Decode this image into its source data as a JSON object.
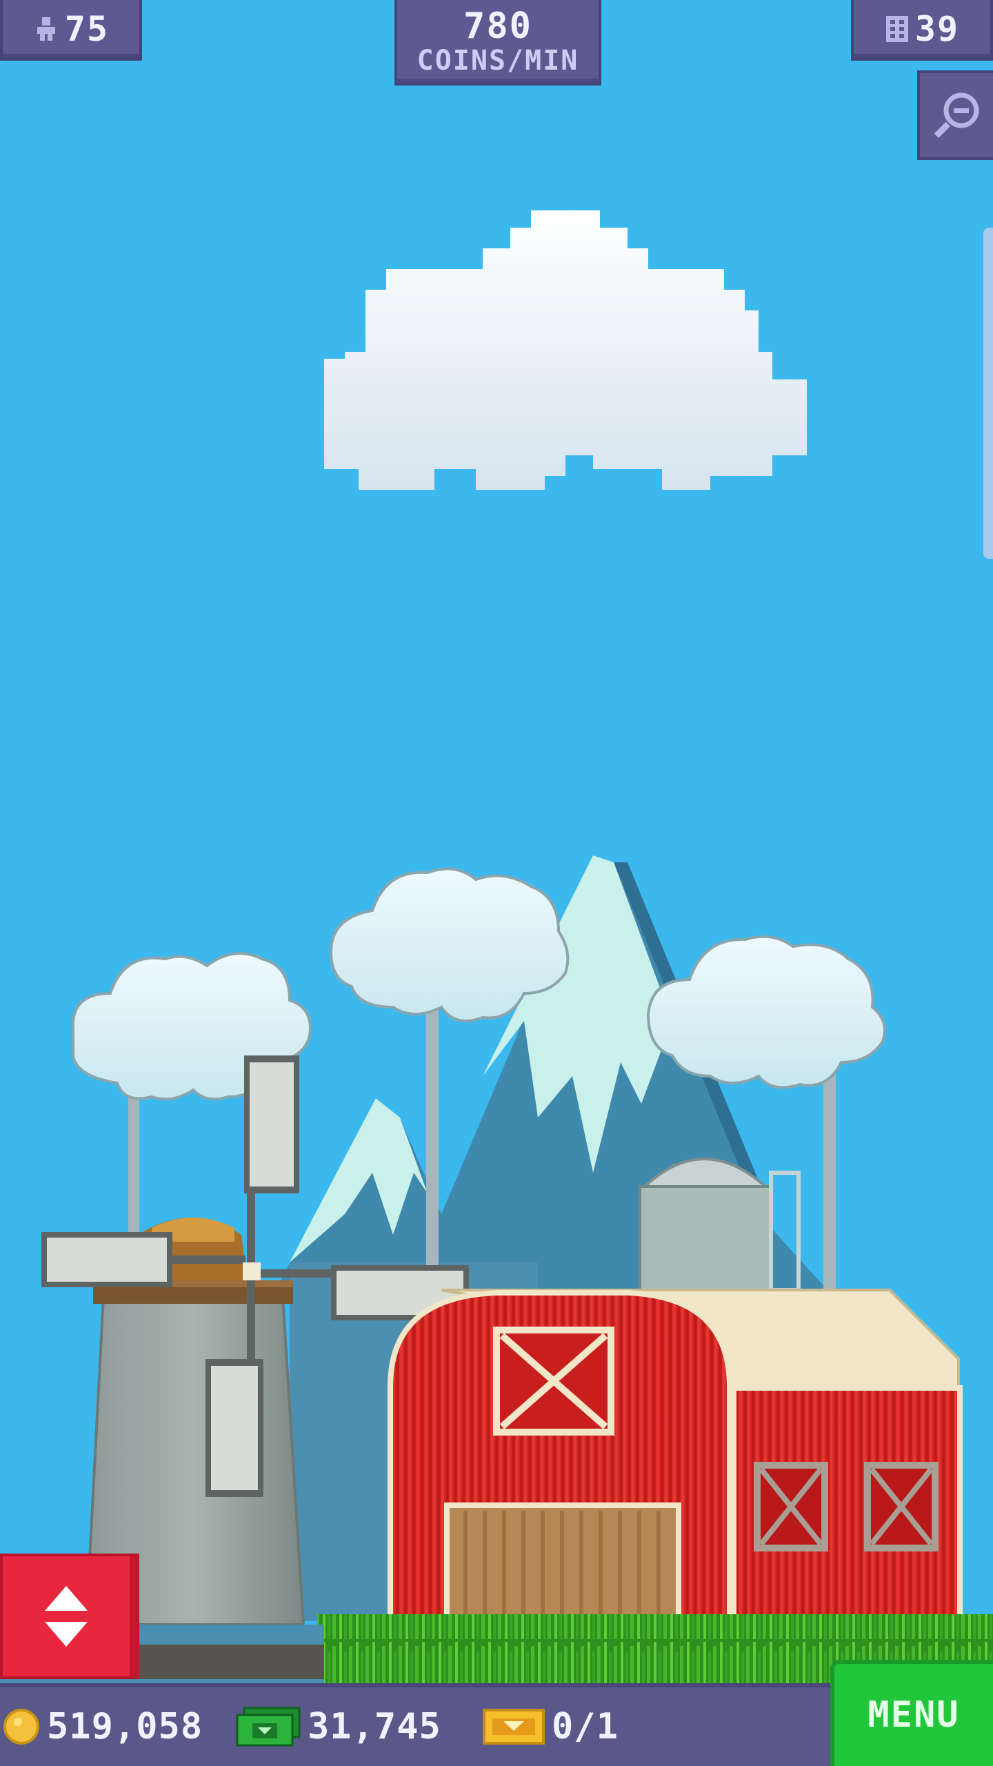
{
  "hud": {
    "population": "75",
    "rate_value": "780",
    "rate_unit": "COINS/MIN",
    "floors": "39"
  },
  "bottom_bar": {
    "coins": "519,058",
    "bux": "31,745",
    "tickets": "0/1",
    "menu_label": "MENU"
  },
  "icons": {
    "population": "person-icon",
    "floors": "building-icon",
    "zoom": "zoom-out-icon",
    "elevator": "elevator-updown-icon",
    "coins": "coin-icon",
    "bux": "bux-icon",
    "tickets": "ticket-icon"
  },
  "colors": {
    "sky": "#3bb9ef",
    "hud": "#5c5a90",
    "menu": "#22c63a",
    "elevator": "#e8273f",
    "barn": "#d92b2b"
  }
}
